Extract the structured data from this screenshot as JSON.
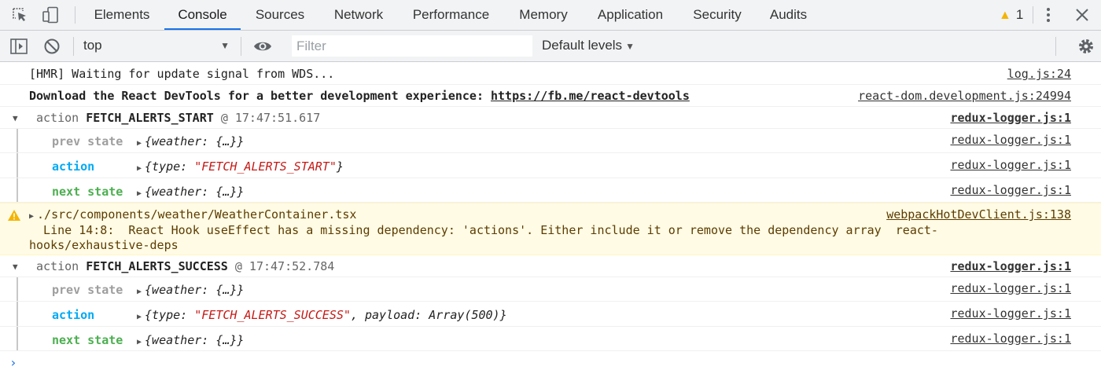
{
  "tabs": [
    "Elements",
    "Console",
    "Sources",
    "Network",
    "Performance",
    "Memory",
    "Application",
    "Security",
    "Audits"
  ],
  "active_tab": "Console",
  "warning_count": "1",
  "toolbar": {
    "context": "top",
    "filter_placeholder": "Filter",
    "levels": "Default levels"
  },
  "messages": {
    "hmr": {
      "text": "[HMR] Waiting for update signal from WDS...",
      "source": "log.js:24"
    },
    "devtools": {
      "text": "Download the React DevTools for a better development experience: ",
      "link": "https://fb.me/react-devtools",
      "source": "react-dom.development.js:24994"
    },
    "group1": {
      "prefix": "action",
      "name": "FETCH_ALERTS_START",
      "at": "@ 17:47:51.617",
      "source": "redux-logger.js:1",
      "prev_label": "prev state",
      "prev_value": "{weather: {…}}",
      "prev_source": "redux-logger.js:1",
      "action_label": "action",
      "action_open": "{type: ",
      "action_type": "\"FETCH_ALERTS_START\"",
      "action_close": "}",
      "action_source": "redux-logger.js:1",
      "next_label": "next state",
      "next_value": "{weather: {…}}",
      "next_source": "redux-logger.js:1"
    },
    "warning": {
      "path": "./src/components/weather/WeatherContainer.tsx",
      "source": "webpackHotDevClient.js:138",
      "line1": "  Line 14:8:  React Hook useEffect has a missing dependency: 'actions'. Either include it or remove the dependency array  react-",
      "line2": "hooks/exhaustive-deps"
    },
    "group2": {
      "prefix": "action",
      "name": "FETCH_ALERTS_SUCCESS",
      "at": "@ 17:47:52.784",
      "source": "redux-logger.js:1",
      "prev_label": "prev state",
      "prev_value": "{weather: {…}}",
      "prev_source": "redux-logger.js:1",
      "action_label": "action",
      "action_open": "{type: ",
      "action_type": "\"FETCH_ALERTS_SUCCESS\"",
      "action_close": ", payload: Array(500)}",
      "action_source": "redux-logger.js:1",
      "next_label": "next state",
      "next_value": "{weather: {…}}",
      "next_source": "redux-logger.js:1"
    }
  },
  "prompt": "›",
  "colors": {
    "accent": "#1a73e8",
    "warning_bg": "#fffbe5",
    "prev": "#9e9e9e",
    "action": "#03a9f4",
    "next": "#4caf50",
    "string": "#c41a16"
  }
}
